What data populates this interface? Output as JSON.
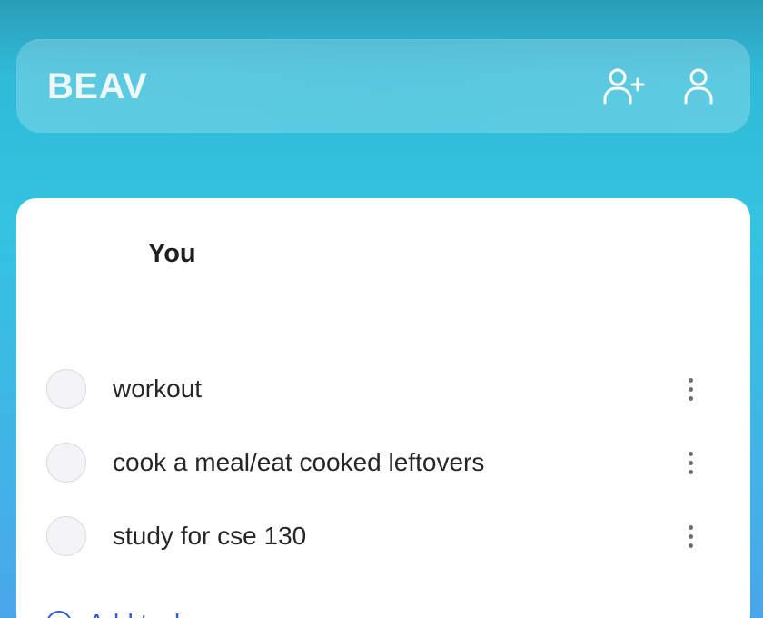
{
  "header": {
    "brand": "BEAV",
    "add_friend_icon": "add-user-icon",
    "profile_icon": "user-icon"
  },
  "card": {
    "title": "You",
    "tasks": [
      {
        "label": "workout",
        "checked": false
      },
      {
        "label": "cook a meal/eat cooked leftovers",
        "checked": false
      },
      {
        "label": "study for cse 130",
        "checked": false
      }
    ],
    "add_task_label": "Add task"
  },
  "colors": {
    "accent": "#2f5fd6",
    "background_top": "#2a9db8",
    "background_bottom": "#4aa6ea"
  }
}
